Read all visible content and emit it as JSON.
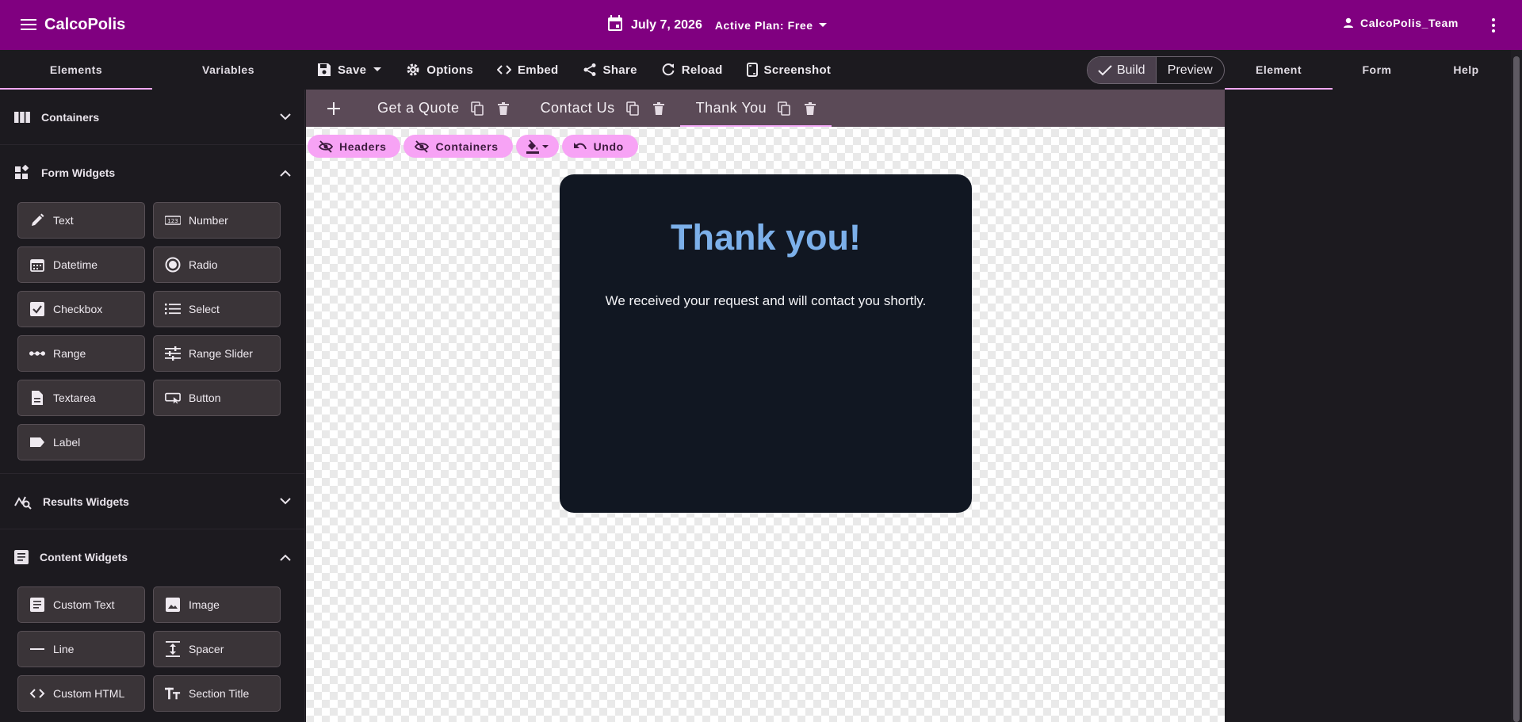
{
  "app": {
    "brand": "CalcoPolis",
    "date": "July 7, 2026",
    "plan": "Active Plan: Free",
    "user": "CalcoPolis_Team"
  },
  "left_tabs": [
    {
      "label": "Elements",
      "active": true
    },
    {
      "label": "Variables",
      "active": false
    }
  ],
  "toolbar": {
    "save": "Save",
    "options": "Options",
    "embed": "Embed",
    "share": "Share",
    "reload": "Reload",
    "screenshot": "Screenshot"
  },
  "mode_toggle": {
    "build": "Build",
    "preview": "Preview"
  },
  "right_tabs": [
    {
      "label": "Element",
      "active": true
    },
    {
      "label": "Form",
      "active": false
    },
    {
      "label": "Help",
      "active": false
    }
  ],
  "sidebar": {
    "containers": "Containers",
    "form_widgets": {
      "title": "Form Widgets",
      "items": [
        "Text",
        "Number",
        "Datetime",
        "Radio",
        "Checkbox",
        "Select",
        "Range",
        "Range Slider",
        "Textarea",
        "Button",
        "Label"
      ]
    },
    "results_widgets": "Results Widgets",
    "content_widgets": {
      "title": "Content Widgets",
      "items": [
        "Custom Text",
        "Image",
        "Line",
        "Spacer",
        "Custom HTML",
        "Section Title"
      ]
    }
  },
  "page_tabs": [
    {
      "label": "Get a Quote",
      "active": false
    },
    {
      "label": "Contact Us",
      "active": false
    },
    {
      "label": "Thank You",
      "active": true
    }
  ],
  "pills": {
    "headers": "Headers",
    "containers": "Containers",
    "undo": "Undo"
  },
  "card": {
    "title": "Thank you!",
    "message": "We received your request and will contact you shortly."
  },
  "colors": {
    "appbar": "#800080",
    "accent": "#f3a8f6",
    "pill": "#f7a3f5",
    "card_bg": "#111722",
    "card_title": "#7cb0ea"
  }
}
